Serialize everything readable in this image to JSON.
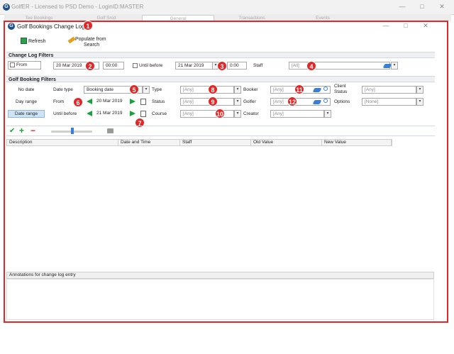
{
  "app": {
    "title": "GolfER - Licensed to PSD Demo - LoginID:MASTER"
  },
  "tabs": [
    "Tee Bookings",
    "Golf Srcd",
    "General",
    "Transactions",
    "Events"
  ],
  "dialog": {
    "title": "Golf Bookings Change Log",
    "toolbar": {
      "refresh": "Refresh",
      "populate_line1": "Populate from",
      "populate_line2": "Search"
    }
  },
  "change_log_filters": {
    "header": "Change Log Filters",
    "from_label": "From",
    "from_date": "20 Mar 2019",
    "from_time": "00:00",
    "until_label": "Until before",
    "until_date": "21 Mar 2019",
    "until_time": "0:00",
    "staff_label": "Staff",
    "staff_value": "[All]"
  },
  "golf_booking_filters": {
    "header": "Golf Booking Filters",
    "modes": [
      "No date",
      "Day range",
      "Date range"
    ],
    "date_type_label": "Date type",
    "date_type_value": "Booking date",
    "from_label": "From",
    "from_date": "20 Mar 2019",
    "until_label": "Until before",
    "until_date": "21 Mar 2019",
    "type_label": "Type",
    "type_value": "[Any]",
    "status_label": "Status",
    "status_value": "[Any]",
    "course_label": "Course",
    "course_value": "[Any]",
    "booker_label": "Booker",
    "booker_value": "[Any]",
    "golfer_label": "Golfer",
    "golfer_value": "[Any]",
    "creator_label": "Creator",
    "creator_value": "[Any]",
    "client_status_label_1": "Client",
    "client_status_label_2": "Status",
    "client_status_value": "[Any]",
    "options_label": "Options",
    "options_value": "[None]"
  },
  "grid": {
    "columns": [
      "Description",
      "Date and Time",
      "Staff",
      "Old Value",
      "New Value"
    ]
  },
  "annotations": {
    "header": "Annotations for change log entry"
  },
  "badges": [
    "1",
    "2",
    "3",
    "4",
    "5",
    "6",
    "7",
    "8",
    "9",
    "10",
    "11",
    "12"
  ],
  "colors": {
    "badge": "#e32626",
    "accent_green": "#18a33a",
    "accent_blue": "#3a7fd5"
  }
}
